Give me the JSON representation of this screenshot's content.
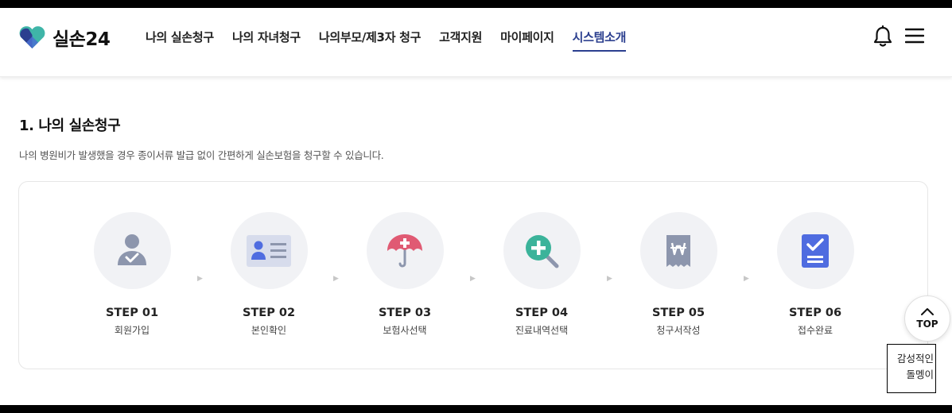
{
  "header": {
    "logo_text": "실손24",
    "nav": [
      {
        "label": "나의 실손청구",
        "active": false
      },
      {
        "label": "나의 자녀청구",
        "active": false
      },
      {
        "label": "나의부모/제3자 청구",
        "active": false
      },
      {
        "label": "고객지원",
        "active": false
      },
      {
        "label": "마이페이지",
        "active": false
      },
      {
        "label": "시스템소개",
        "active": true
      }
    ],
    "icons": [
      "bell-icon",
      "hamburger-menu-icon"
    ]
  },
  "section": {
    "title": "1. 나의 실손청구",
    "description": "나의 병원비가 발생했을 경우 종이서류 발급 없이 간편하게 실손보험을 청구할 수 있습니다."
  },
  "steps": [
    {
      "label": "STEP 01",
      "name": "회원가입",
      "icon": "user-check-icon"
    },
    {
      "label": "STEP 02",
      "name": "본인확인",
      "icon": "id-card-icon"
    },
    {
      "label": "STEP 03",
      "name": "보험사선택",
      "icon": "umbrella-icon"
    },
    {
      "label": "STEP 04",
      "name": "진료내역선택",
      "icon": "magnifier-plus-icon"
    },
    {
      "label": "STEP 05",
      "name": "청구서작성",
      "icon": "receipt-won-icon"
    },
    {
      "label": "STEP 06",
      "name": "접수완료",
      "icon": "clipboard-check-icon"
    }
  ],
  "top_button": {
    "label": "TOP"
  },
  "mascot": {
    "line1": "감성적인",
    "line2": "돌멩이"
  },
  "colors": {
    "accent": "#2b3f8f",
    "icon_gray": "#8d96ad",
    "icon_pink": "#e05a73",
    "icon_green": "#3bb39a",
    "icon_blue": "#4f6ce0",
    "circle_bg": "#f1f2f5"
  }
}
